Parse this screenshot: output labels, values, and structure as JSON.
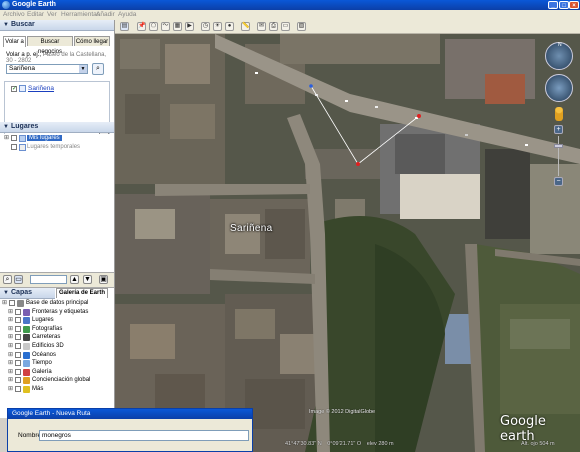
{
  "window": {
    "title": "Google Earth"
  },
  "menu": [
    "Archivo",
    "Editar",
    "Ver",
    "Herramientas",
    "Añadir",
    "Ayuda"
  ],
  "search": {
    "header": "Buscar",
    "tabs": [
      "Volar a",
      "Buscar negocios",
      "Cómo llegar"
    ],
    "hint_prefix": "Volar a p. ej.,",
    "hint_example": "Paseo de la Castellana, 30 - 2802",
    "value": "Sariñena",
    "result": "Sariñena"
  },
  "places": {
    "header": "Lugares",
    "items": [
      {
        "label": "Mis lugares"
      },
      {
        "label": "Lugares temporales"
      }
    ]
  },
  "layers": {
    "header": "Capas",
    "gallery_tab": "Galería de Earth",
    "items": [
      {
        "label": "Base de datos principal",
        "icon": "database-icon",
        "color": "#888888"
      },
      {
        "label": "Fronteras y etiquetas",
        "icon": "flag-icon",
        "color": "#7a5fb0"
      },
      {
        "label": "Lugares",
        "icon": "places-icon",
        "color": "#4a76c8"
      },
      {
        "label": "Fotografías",
        "icon": "photo-icon",
        "color": "#3f9a4c"
      },
      {
        "label": "Carreteras",
        "icon": "road-icon",
        "color": "#444444"
      },
      {
        "label": "Edificios 3D",
        "icon": "building-icon",
        "color": "#c8c8c8"
      },
      {
        "label": "Océanos",
        "icon": "ocean-icon",
        "color": "#2a6fd0"
      },
      {
        "label": "Tiempo",
        "icon": "weather-icon",
        "color": "#7aa8e0"
      },
      {
        "label": "Galería",
        "icon": "gallery-icon",
        "color": "#d04040"
      },
      {
        "label": "Concienciación global",
        "icon": "globe-icon",
        "color": "#e0a020"
      },
      {
        "label": "Más",
        "icon": "more-icon",
        "color": "#e0c020"
      }
    ]
  },
  "map": {
    "place_label": "Sariñena",
    "imagery_credit": "Image © 2012 DigitalGlobe",
    "coords": "41°47'30.83\" N",
    "lon": "0°09'21.71\" O",
    "elev": "elev  280 m",
    "eye_alt": "Alt. ojo  504 m",
    "logo": "Google earth",
    "compass_north": "N"
  },
  "dialog": {
    "title": "Google Earth - Nueva Ruta",
    "name_label": "Nombre:",
    "name_value": "monegros"
  },
  "colors": {
    "titlebar": "#0b4fc8",
    "selection": "#316ac5",
    "path_line": "#ffffff",
    "path_point": "#e02020"
  }
}
